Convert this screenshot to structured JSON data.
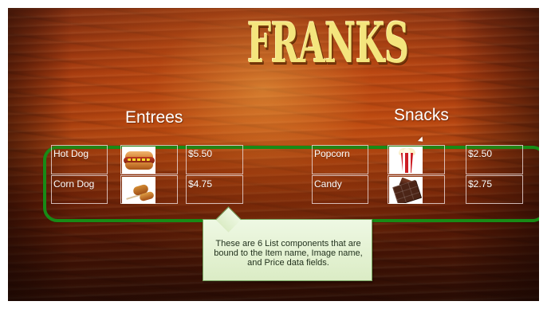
{
  "title": "FRANKS",
  "sections": {
    "entrees_label": "Entrees",
    "snacks_label": "Snacks"
  },
  "entrees": [
    {
      "name": "Hot Dog",
      "image_icon": "hot-dog-image",
      "price": "$5.50"
    },
    {
      "name": "Corn Dog",
      "image_icon": "corn-dog-image",
      "price": "$4.75"
    }
  ],
  "snacks": [
    {
      "name": "Popcorn",
      "image_icon": "popcorn-image",
      "price": "$2.50"
    },
    {
      "name": "Candy",
      "image_icon": "chocolate-candy-image",
      "price": "$2.75"
    }
  ],
  "callout": {
    "text": "These are 6 List components that are bound to the Item name, Image name, and Price data fields."
  },
  "colors": {
    "highlight": "#188b16",
    "title": "#f4e57d",
    "callout_bg": "#e6f3d8"
  }
}
